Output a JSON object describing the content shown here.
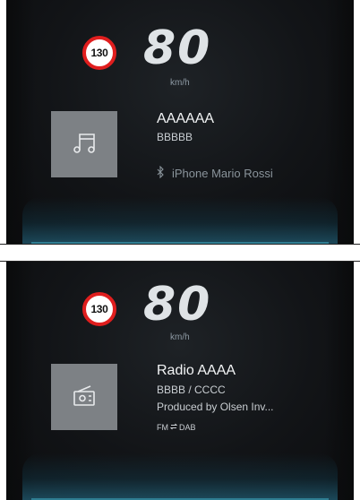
{
  "screen_1": {
    "speed_limit": "130",
    "speed": "80",
    "unit": "km/h",
    "tile_icon": "music-note-icon",
    "title": "AAAAAA",
    "subtitle": "BBBBB",
    "device_icon": "bluetooth-icon",
    "device": "iPhone Mario Rossi"
  },
  "screen_2": {
    "speed_limit": "130",
    "speed": "80",
    "unit": "km/h",
    "tile_icon": "radio-icon",
    "title": "Radio AAAA",
    "line1": "BBBB / CCCC",
    "line2": "Produced by Olsen Inv...",
    "source_from": "FM",
    "source_swap_icon": "swap-arrows-icon",
    "source_to": "DAB"
  },
  "colors": {
    "speed_limit_ring": "#e01e1e",
    "tile": "#7d8185",
    "glow": "#2f7e93"
  }
}
